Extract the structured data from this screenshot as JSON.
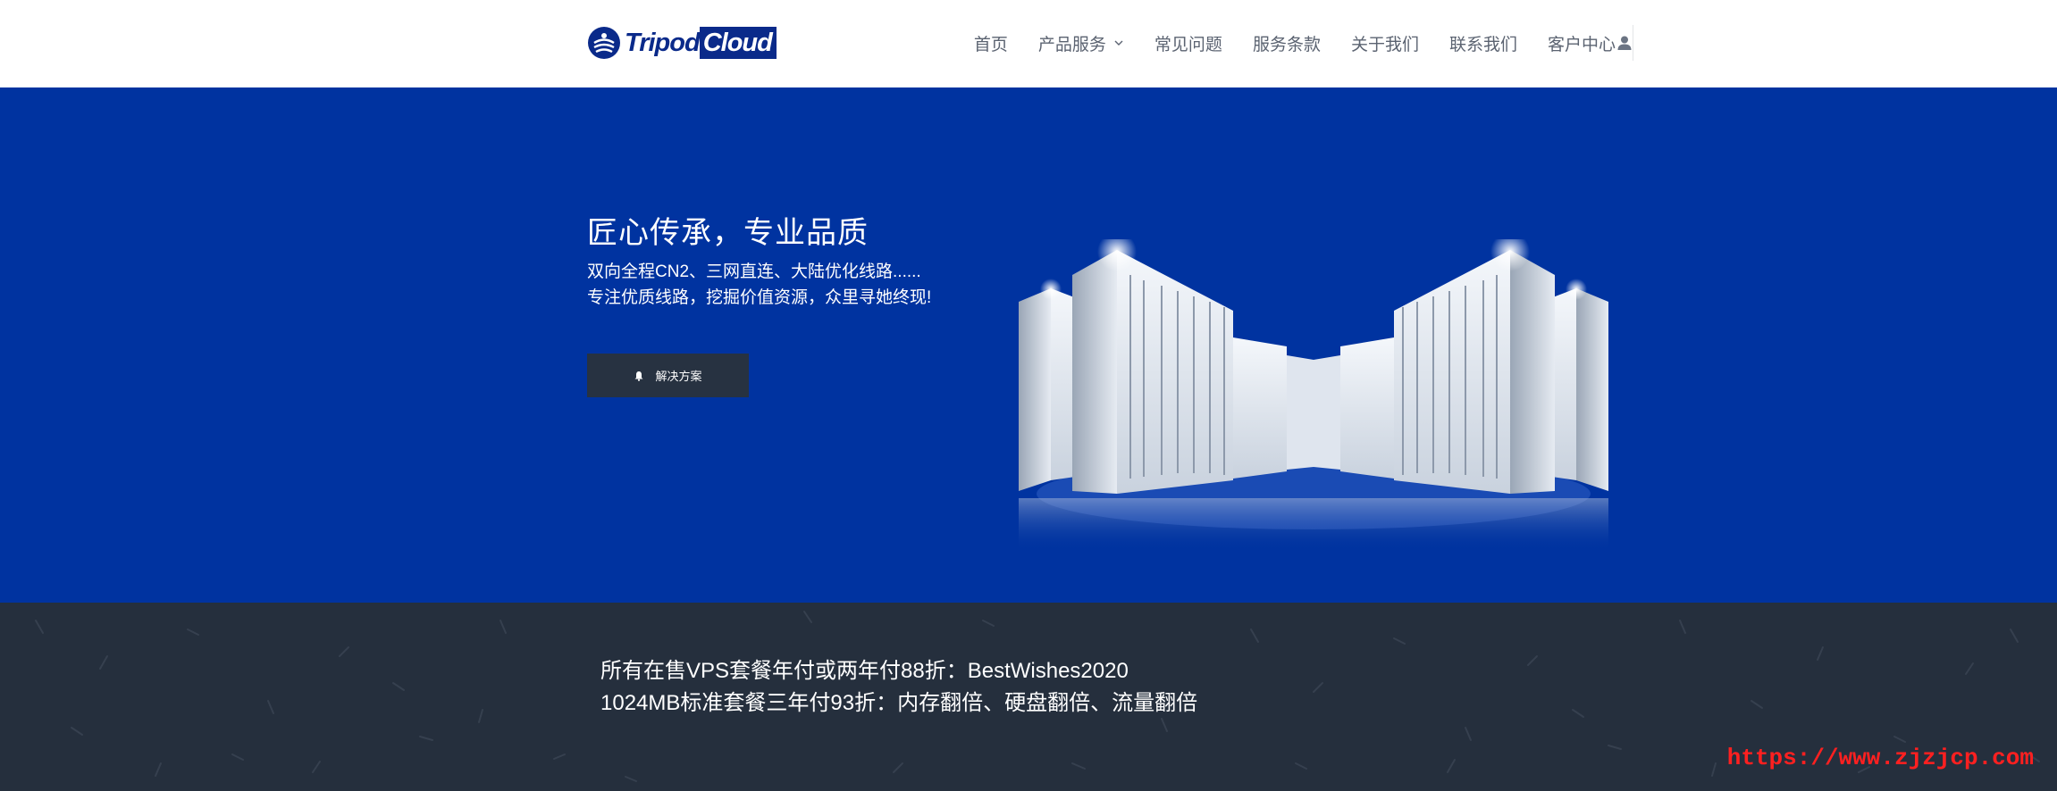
{
  "header": {
    "logo": {
      "word1": "Tripod",
      "word2": "Cloud"
    },
    "nav": [
      {
        "label": "首页"
      },
      {
        "label": "产品服务"
      },
      {
        "label": "常见问题"
      },
      {
        "label": "服务条款"
      },
      {
        "label": "关于我们"
      },
      {
        "label": "联系我们"
      },
      {
        "label": "客户中心"
      }
    ]
  },
  "hero": {
    "title": "匠心传承，专业品质",
    "line1": "双向全程CN2、三网直连、大陆优化线路......",
    "line2": "专注优质线路，挖掘价值资源，众里寻她终现!",
    "button_label": "解决方案"
  },
  "promo": {
    "line1": "所有在售VPS套餐年付或两年付88折：BestWishes2020",
    "line2": "1024MB标准套餐三年付93折：内存翻倍、硬盘翻倍、流量翻倍"
  },
  "watermark": "https://www.zjzjcp.com",
  "colors": {
    "hero_bg": "#0033a0",
    "promo_bg": "#252f3d",
    "button_bg": "#273241",
    "nav_text": "#5b6371",
    "brand": "#0a2a8a",
    "watermark": "#ff2020"
  },
  "icons": {
    "logo": "logo-globe-icon",
    "nav_dropdown": "chevron-down-icon",
    "account": "user-icon",
    "button": "bell-icon"
  }
}
